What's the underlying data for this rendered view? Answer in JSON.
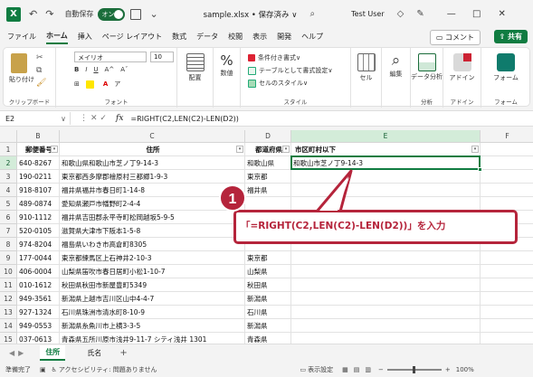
{
  "titlebar": {
    "app_icon": "excel-logo",
    "autosave_label": "自動保存",
    "autosave_state": "オン",
    "document_title": "sample.xlsx • 保存済み ∨",
    "user_name": "Test User"
  },
  "menu": {
    "tabs": [
      "ファイル",
      "ホーム",
      "挿入",
      "ページ レイアウト",
      "数式",
      "データ",
      "校閲",
      "表示",
      "開発",
      "ヘルプ"
    ],
    "active_tab": "ホーム",
    "comment_button": "コメント",
    "share_button": "共有"
  },
  "ribbon": {
    "clipboard": {
      "paste": "貼り付け",
      "label": "クリップボード"
    },
    "font": {
      "font_name": "メイリオ",
      "font_size": "10",
      "label": "フォント"
    },
    "alignment": {
      "label": "配置"
    },
    "number": {
      "label": "数値"
    },
    "styles": {
      "conditional": "条件付き書式",
      "table": "テーブルとして書式設定",
      "cell_styles": "セルのスタイル",
      "label": "スタイル"
    },
    "cells": {
      "label": "セル"
    },
    "editing": {
      "label": "編集"
    },
    "analysis": {
      "button": "データ分析",
      "label": "分析"
    },
    "addins": {
      "button": "アドイン",
      "label": "アドイン"
    },
    "forms": {
      "button": "フォーム",
      "label": "フォーム"
    }
  },
  "formula_bar": {
    "name_box": "E2",
    "fx": "fx",
    "formula": "=RIGHT(C2,LEN(C2)-LEN(D2))"
  },
  "grid": {
    "columns": [
      "B",
      "C",
      "D",
      "E",
      "F"
    ],
    "header_row": [
      "郵便番号",
      "住所",
      "都道府県",
      "市区町村以下"
    ],
    "rows": [
      {
        "num": "2",
        "b": "640-8267",
        "c": "和歌山県和歌山市芝ノ丁9-14-3",
        "d": "和歌山県",
        "e": "和歌山市芝ノ丁9-14-3"
      },
      {
        "num": "3",
        "b": "190-0211",
        "c": "東京都西多摩郡檜原村三都郷1-9-3",
        "d": "東京都",
        "e": ""
      },
      {
        "num": "4",
        "b": "918-8107",
        "c": "福井県福井市春日町1-14-8",
        "d": "福井県",
        "e": ""
      },
      {
        "num": "5",
        "b": "489-0874",
        "c": "愛知県瀬戸市幡野町2-4-4",
        "d": "",
        "e": ""
      },
      {
        "num": "6",
        "b": "910-1112",
        "c": "福井県吉田郡永平寺町松岡越坂5-9-5",
        "d": "",
        "e": ""
      },
      {
        "num": "7",
        "b": "520-0105",
        "c": "滋賀県大津市下阪本1-5-8",
        "d": "",
        "e": ""
      },
      {
        "num": "8",
        "b": "974-8204",
        "c": "福島県いわき市高倉町8305",
        "d": "",
        "e": ""
      },
      {
        "num": "9",
        "b": "177-0044",
        "c": "東京都練馬区上石神井2-10-3",
        "d": "東京都",
        "e": ""
      },
      {
        "num": "10",
        "b": "406-0004",
        "c": "山梨県笛吹市春日居町小松1-10-7",
        "d": "山梨県",
        "e": ""
      },
      {
        "num": "11",
        "b": "010-1612",
        "c": "秋田県秋田市新屋豊町5349",
        "d": "秋田県",
        "e": ""
      },
      {
        "num": "12",
        "b": "949-3561",
        "c": "新潟県上越市吉川区山中4-4-7",
        "d": "新潟県",
        "e": ""
      },
      {
        "num": "13",
        "b": "927-1324",
        "c": "石川県珠洲市清水町8-10-9",
        "d": "石川県",
        "e": ""
      },
      {
        "num": "14",
        "b": "949-0553",
        "c": "新潟県糸魚川市上横3-3-5",
        "d": "新潟県",
        "e": ""
      },
      {
        "num": "15",
        "b": "037-0613",
        "c": "青森県五所川原市浅井9-11-7 シティ浅井 1301",
        "d": "青森県",
        "e": ""
      }
    ]
  },
  "callout": {
    "badge": "1",
    "text": "「=RIGHT(C2,LEN(C2)-LEN(D2))」を入力"
  },
  "sheets": {
    "tabs": [
      "住所",
      "氏名"
    ],
    "active": "住所",
    "add": "+"
  },
  "status": {
    "ready": "準備完了",
    "accessibility": "アクセシビリティ: 問題ありません",
    "display_settings": "表示設定",
    "zoom": "100%"
  }
}
